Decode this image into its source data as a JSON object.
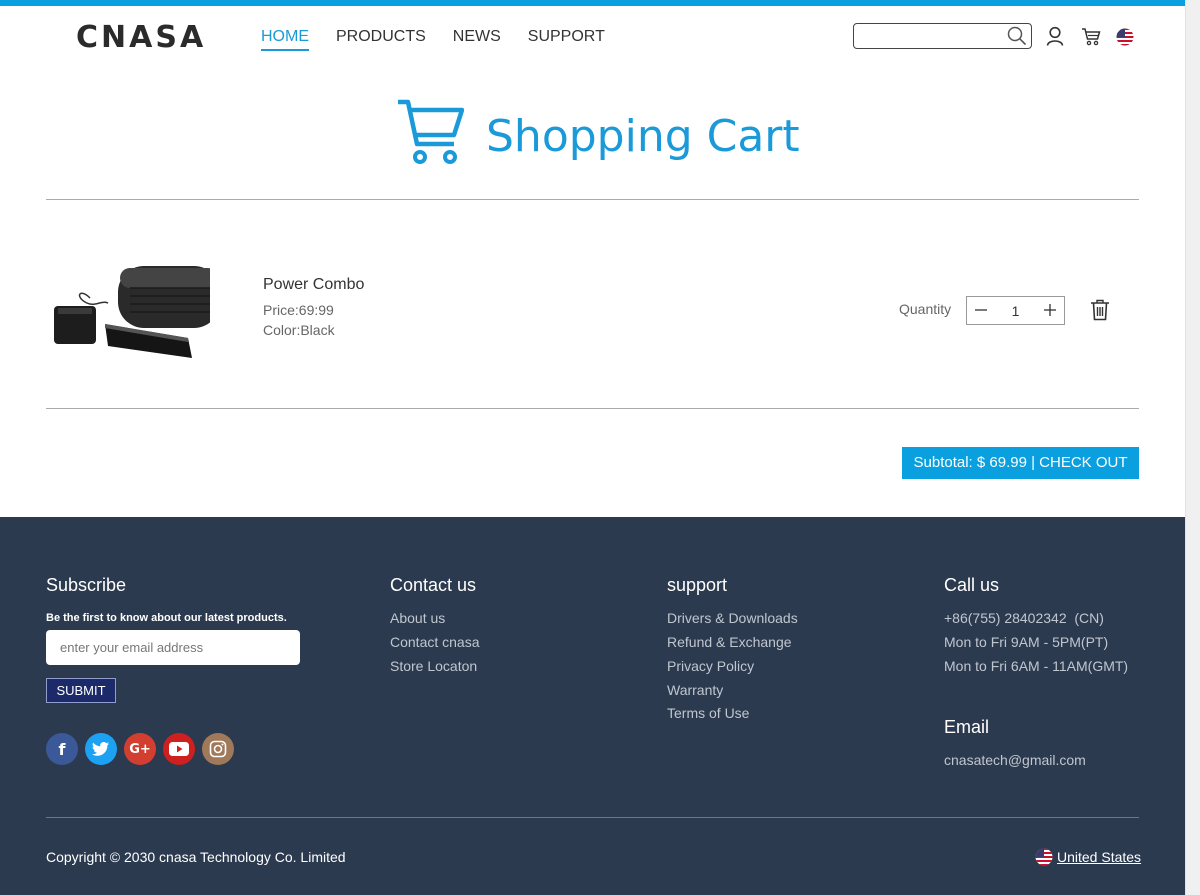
{
  "header": {
    "logo": "CNASA",
    "nav": [
      "HOME",
      "PRODUCTS",
      "NEWS",
      "SUPPORT"
    ],
    "search_value": "",
    "icons": [
      "search-icon",
      "user-icon",
      "cart-icon",
      "us-flag-icon"
    ]
  },
  "page_title": "Shopping Cart",
  "cart": {
    "item": {
      "name": "Power Combo",
      "price": "Price:69:99",
      "color": "Color:Black"
    },
    "quantity_label": "Quantity",
    "quantity": "1",
    "checkout_label": "Subtotal: $ 69.99 | CHECK OUT"
  },
  "footer": {
    "subscribe": {
      "title": "Subscribe",
      "subtitle": "Be the first to know about our latest products.",
      "placeholder": "enter your email address",
      "submit": "SUBMIT"
    },
    "contact": {
      "title": "Contact us",
      "links": [
        "About us",
        "Contact cnasa",
        "Store Locaton"
      ]
    },
    "support": {
      "title": "support",
      "links": [
        "Drivers & Downloads",
        "Refund & Exchange",
        "Privacy Policy",
        "Warranty",
        "Terms of Use"
      ]
    },
    "call": {
      "title": "Call us",
      "lines": [
        "+86(755) 28402342  (CN)",
        "Mon to Fri 9AM - 5PM(PT)",
        "Mon to Fri 6AM - 11AM(GMT)"
      ]
    },
    "email": {
      "title": "Email",
      "address": "cnasatech@gmail.com"
    },
    "social_icons": [
      "facebook-icon",
      "twitter-icon",
      "google-plus-icon",
      "youtube-icon",
      "instagram-icon"
    ],
    "social_colors": [
      "#3b5998",
      "#1da1f2",
      "#d23f31",
      "#cd201f",
      "#a0785a"
    ],
    "copyright": "Copyright © 2030 cnasa Technology Co. Limited",
    "region": "United States"
  }
}
